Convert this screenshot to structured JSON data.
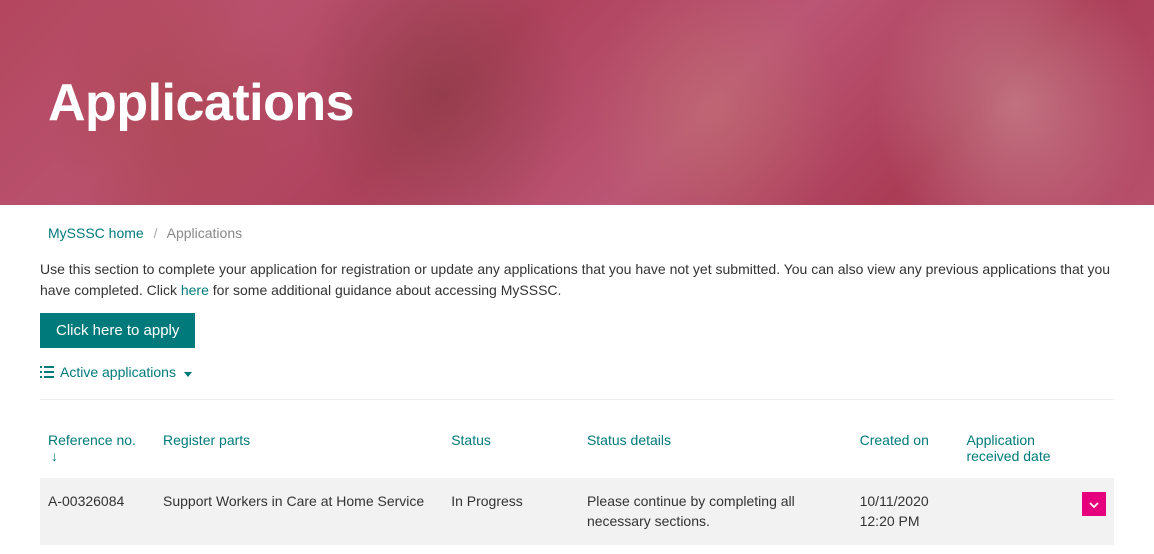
{
  "hero": {
    "title": "Applications"
  },
  "breadcrumb": {
    "home": "MySSSC home",
    "current": "Applications"
  },
  "description": {
    "text_before_link": "Use this section to complete your application for registration or update any applications that you have not yet submitted. You can also view any previous applications that you have completed. Click ",
    "link": "here",
    "text_after_link": " for some additional guidance about accessing MySSSC."
  },
  "buttons": {
    "apply": "Click here to apply"
  },
  "filters": {
    "active_label": "Active applications"
  },
  "table": {
    "headers": {
      "reference": "Reference no.",
      "register_parts": "Register parts",
      "status": "Status",
      "status_details": "Status details",
      "created_on": "Created on",
      "received_date": "Application received date"
    },
    "rows": [
      {
        "reference": "A-00326084",
        "register_parts": "Support Workers in Care at Home Service",
        "status": "In Progress",
        "status_details": "Please continue by completing all necessary sections.",
        "created_on": "10/11/2020 12:20 PM",
        "received_date": ""
      }
    ]
  },
  "colors": {
    "accent_teal": "#007a7a",
    "accent_magenta": "#e6007e"
  }
}
